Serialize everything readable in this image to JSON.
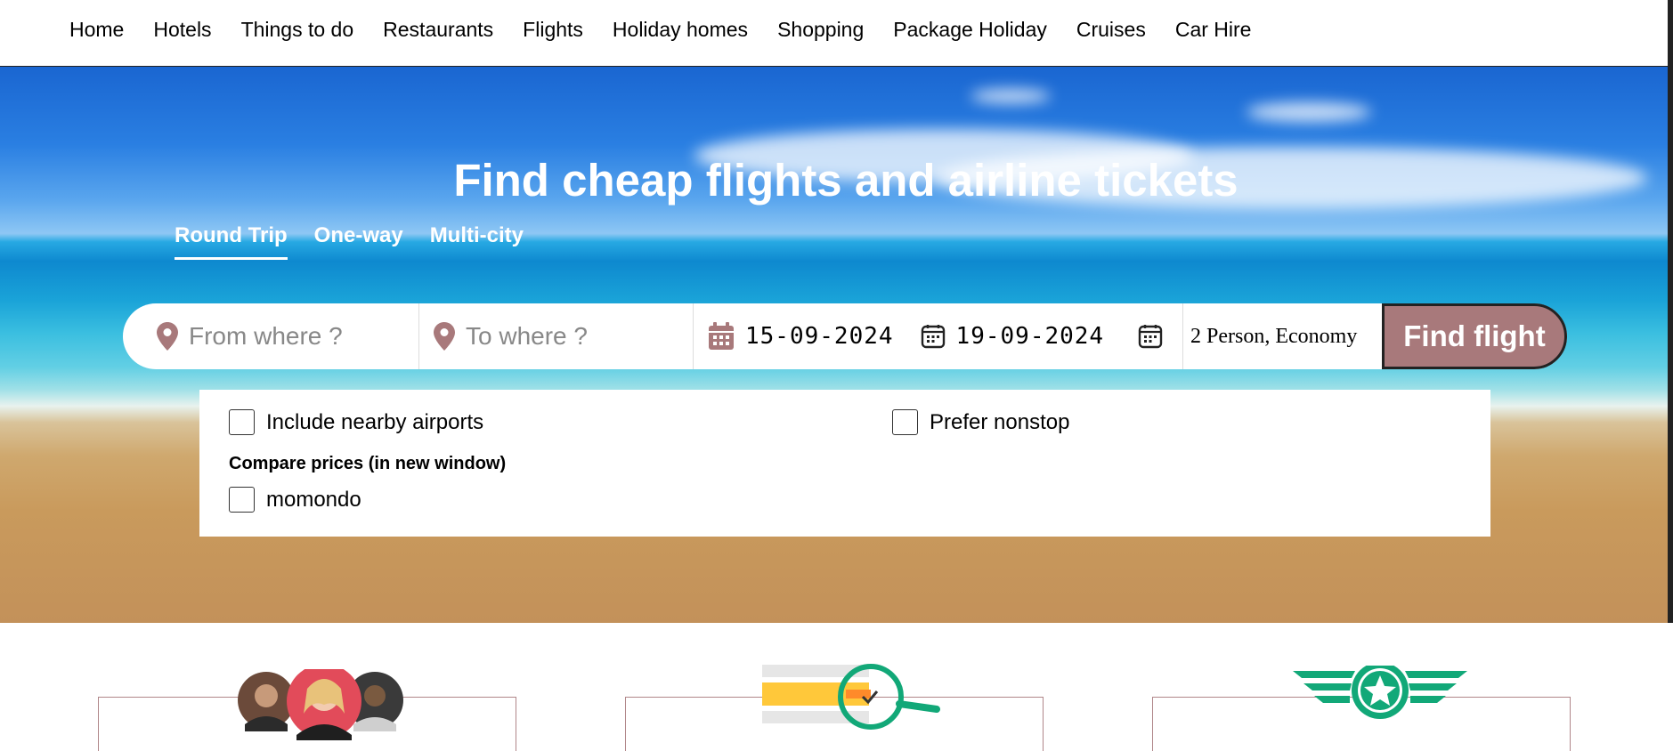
{
  "nav": {
    "items": [
      "Home",
      "Hotels",
      "Things to do",
      "Restaurants",
      "Flights",
      "Holiday homes",
      "Shopping",
      "Package Holiday",
      "Cruises",
      "Car Hire"
    ]
  },
  "hero": {
    "title": "Find cheap flights and airline tickets",
    "tabs": [
      {
        "label": "Round Trip",
        "active": true
      },
      {
        "label": "One-way",
        "active": false
      },
      {
        "label": "Multi-city",
        "active": false
      }
    ]
  },
  "search": {
    "from_placeholder": "From where ?",
    "to_placeholder": "To where ?",
    "depart_date": "15-09-2024",
    "return_date": "19-09-2024",
    "passengers": "2 Person, Economy",
    "submit_label": "Find flight"
  },
  "options": {
    "nearby_airports": "Include nearby airports",
    "prefer_nonstop": "Prefer nonstop",
    "compare_heading": "Compare prices (in new window)",
    "momondo": "momondo"
  },
  "colors": {
    "accent": "#a8797b",
    "card_border": "#b08689",
    "badge_green": "#12a878",
    "pin": "#a8797b"
  },
  "icons": {
    "location": "map-pin-icon",
    "calendar": "calendar-icon"
  }
}
